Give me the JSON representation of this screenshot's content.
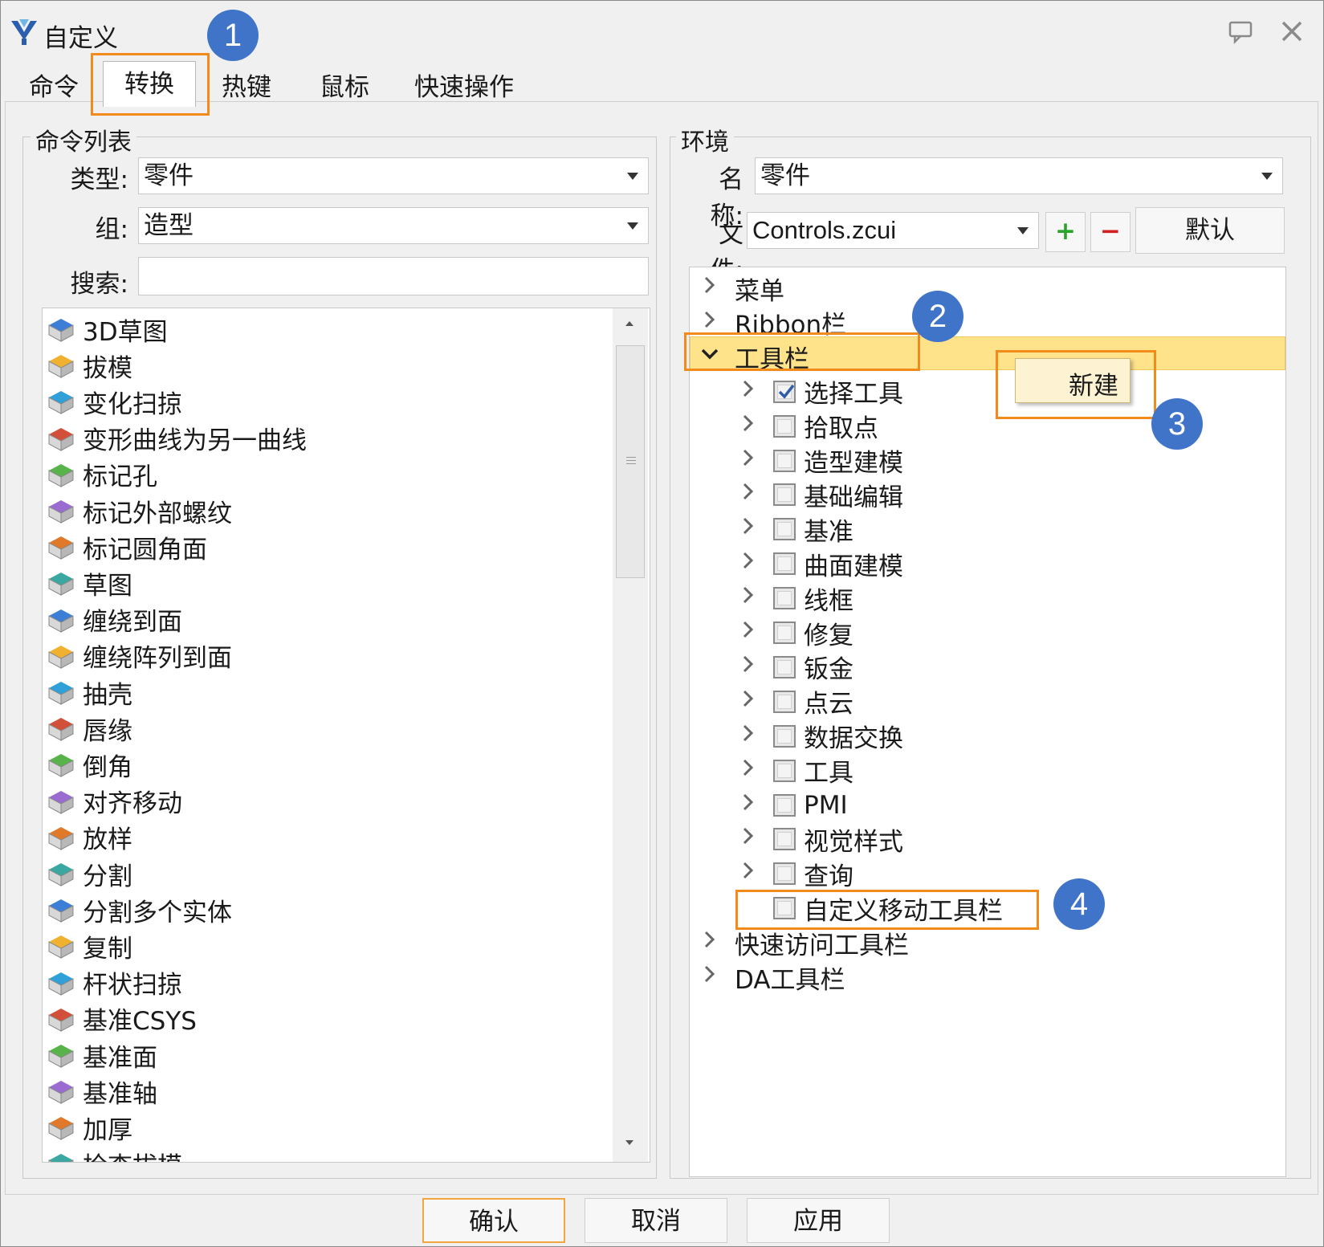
{
  "window": {
    "title": "自定义"
  },
  "tabs": [
    {
      "label": "命令"
    },
    {
      "label": "转换"
    },
    {
      "label": "热键"
    },
    {
      "label": "鼠标"
    },
    {
      "label": "快速操作"
    }
  ],
  "left": {
    "group_title": "命令列表",
    "type_label": "类型:",
    "type_value": "零件",
    "group_label": "组:",
    "group_value": "造型",
    "search_label": "搜索:",
    "search_value": "",
    "commands": [
      {
        "label": "3D草图",
        "icon": "3d-sketch-icon"
      },
      {
        "label": "拔模",
        "icon": "draft-icon"
      },
      {
        "label": "变化扫掠",
        "icon": "variable-sweep-icon"
      },
      {
        "label": "变形曲线为另一曲线",
        "icon": "morph-curve-icon"
      },
      {
        "label": "标记孔",
        "icon": "mark-hole-icon"
      },
      {
        "label": "标记外部螺纹",
        "icon": "mark-thread-icon"
      },
      {
        "label": "标记圆角面",
        "icon": "mark-fillet-icon"
      },
      {
        "label": "草图",
        "icon": "sketch-icon"
      },
      {
        "label": "缠绕到面",
        "icon": "wrap-to-face-icon"
      },
      {
        "label": "缠绕阵列到面",
        "icon": "wrap-pattern-icon"
      },
      {
        "label": "抽壳",
        "icon": "shell-icon"
      },
      {
        "label": "唇缘",
        "icon": "lip-icon"
      },
      {
        "label": "倒角",
        "icon": "chamfer-icon"
      },
      {
        "label": "对齐移动",
        "icon": "align-move-icon"
      },
      {
        "label": "放样",
        "icon": "loft-icon"
      },
      {
        "label": "分割",
        "icon": "split-icon"
      },
      {
        "label": "分割多个实体",
        "icon": "split-multi-icon"
      },
      {
        "label": "复制",
        "icon": "copy-icon"
      },
      {
        "label": "杆状扫掠",
        "icon": "rod-sweep-icon"
      },
      {
        "label": "基准CSYS",
        "icon": "datum-csys-icon"
      },
      {
        "label": "基准面",
        "icon": "datum-plane-icon"
      },
      {
        "label": "基准轴",
        "icon": "datum-axis-icon"
      },
      {
        "label": "加厚",
        "icon": "thicken-icon"
      },
      {
        "label": "检查拔模",
        "icon": "check-draft-icon"
      }
    ]
  },
  "right": {
    "group_title": "环境",
    "name_label": "名称:",
    "name_value": "零件",
    "file_label": "文件:",
    "file_value": "Controls.zcui",
    "add_symbol": "+",
    "remove_symbol": "−",
    "default_label": "默认",
    "tree": {
      "menu": "菜单",
      "ribbon": "Ribbon栏",
      "toolbar": "工具栏",
      "toolbar_children": [
        {
          "label": "选择工具",
          "checked": true
        },
        {
          "label": "拾取点",
          "checked": false
        },
        {
          "label": "造型建模",
          "checked": false
        },
        {
          "label": "基础编辑",
          "checked": false
        },
        {
          "label": "基准",
          "checked": false
        },
        {
          "label": "曲面建模",
          "checked": false
        },
        {
          "label": "线框",
          "checked": false
        },
        {
          "label": "修复",
          "checked": false
        },
        {
          "label": "钣金",
          "checked": false
        },
        {
          "label": "点云",
          "checked": false
        },
        {
          "label": "数据交换",
          "checked": false
        },
        {
          "label": "工具",
          "checked": false
        },
        {
          "label": "PMI",
          "checked": false
        },
        {
          "label": "视觉样式",
          "checked": false
        },
        {
          "label": "查询",
          "checked": false
        }
      ],
      "new_toolbar": "自定义移动工具栏",
      "quick_access": "快速访问工具栏",
      "da_toolbar": "DA工具栏"
    },
    "context_menu": {
      "new_label": "新建"
    }
  },
  "footer": {
    "ok": "确认",
    "cancel": "取消",
    "apply": "应用"
  },
  "annotations": [
    "1",
    "2",
    "3",
    "4"
  ],
  "colors": {
    "highlight_orange": "#f28a1c",
    "badge_blue": "#3f74c8",
    "selected_row": "#ffe38a"
  }
}
